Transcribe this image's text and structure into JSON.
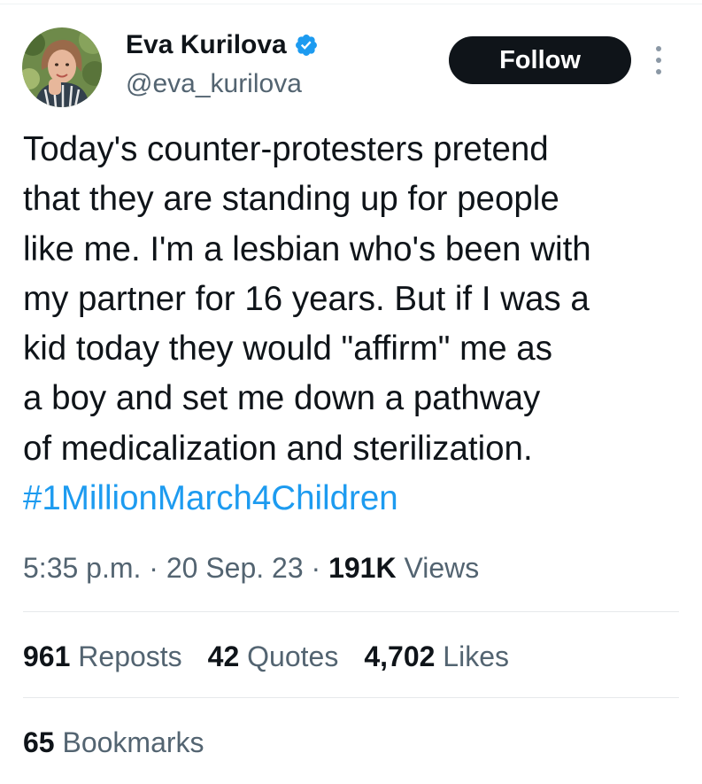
{
  "author": {
    "display_name": "Eva Kurilova",
    "handle": "@eva_kurilova",
    "verified": true
  },
  "actions": {
    "follow_label": "Follow",
    "more_icon": "more-vertical-icon"
  },
  "tweet": {
    "text_lines": [
      "Today's counter-protesters pretend",
      "that they are standing up for people",
      "like me. I'm a lesbian who's been with",
      "my partner for 16 years. But if I was a",
      "kid today they would \"affirm\" me as",
      "a boy and set me down a pathway",
      "of medicalization and sterilization."
    ],
    "hashtag": "#1MillionMarch4Children"
  },
  "meta": {
    "time": "5:35 p.m.",
    "separator": " · ",
    "date": "20 Sep. 23",
    "views_count": "191K",
    "views_label": "Views"
  },
  "stats": {
    "reposts_count": "961",
    "reposts_label": "Reposts",
    "quotes_count": "42",
    "quotes_label": "Quotes",
    "likes_count": "4,702",
    "likes_label": "Likes",
    "bookmarks_count": "65",
    "bookmarks_label": "Bookmarks"
  },
  "colors": {
    "text": "#0f1419",
    "secondary": "#536471",
    "link": "#1d9bf0",
    "verified": "#1d9bf0",
    "follow_bg": "#0f1419"
  }
}
